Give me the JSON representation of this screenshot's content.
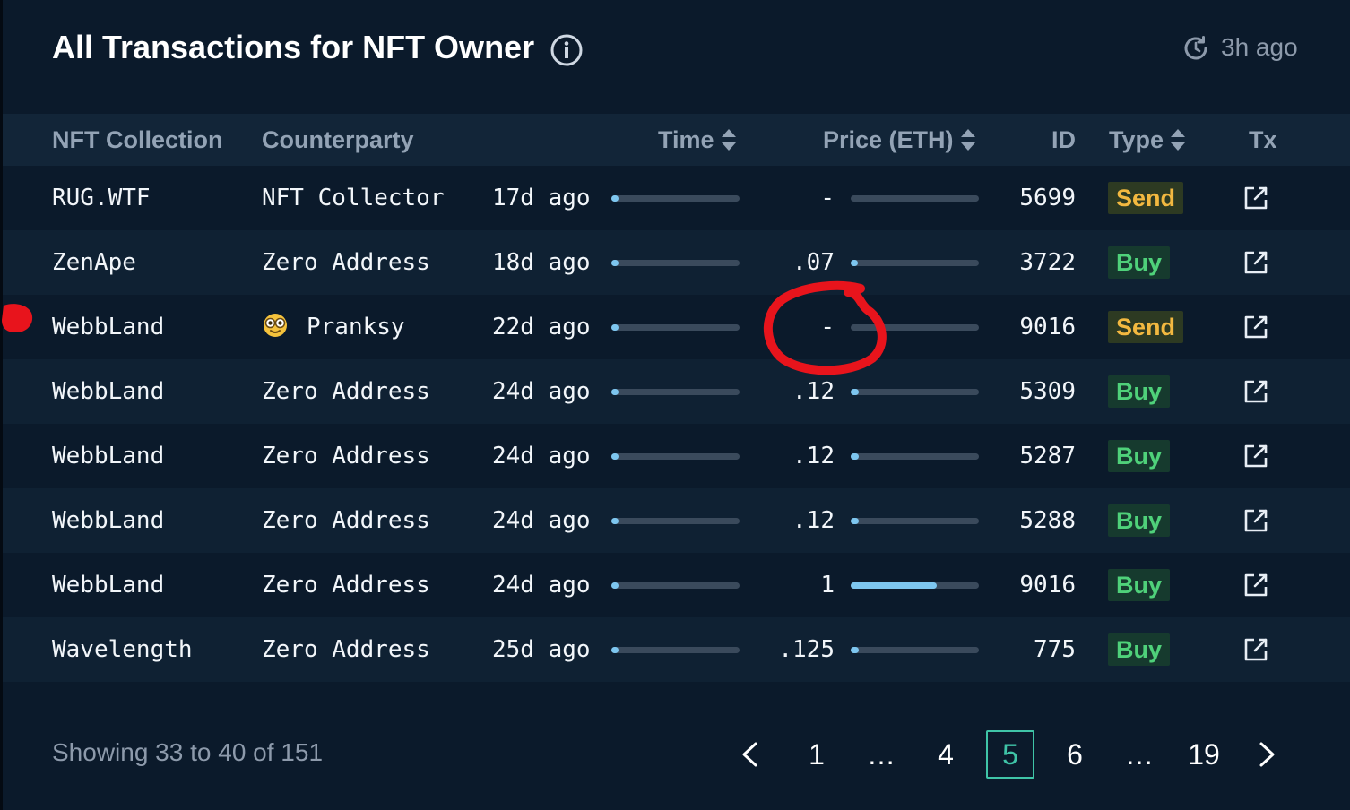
{
  "header": {
    "title": "All Transactions for NFT Owner",
    "updated": "3h ago"
  },
  "table": {
    "columns": {
      "collection": "NFT Collection",
      "counterparty": "Counterparty",
      "time": "Time",
      "price": "Price (ETH)",
      "id": "ID",
      "type": "Type",
      "tx": "Tx"
    },
    "rows": [
      {
        "collection": "RUG.WTF",
        "counterparty": "NFT Collector",
        "emoji": false,
        "time": "17d ago",
        "time_level": 0.02,
        "price": "-",
        "price_level": 0.0,
        "id": "5699",
        "type": "Send"
      },
      {
        "collection": "ZenApe",
        "counterparty": "Zero Address",
        "emoji": false,
        "time": "18d ago",
        "time_level": 0.03,
        "price": ".07",
        "price_level": 0.04,
        "id": "3722",
        "type": "Buy"
      },
      {
        "collection": "WebbLand",
        "counterparty": "Pranksy",
        "emoji": true,
        "time": "22d ago",
        "time_level": 0.04,
        "price": "-",
        "price_level": 0.0,
        "id": "9016",
        "type": "Send"
      },
      {
        "collection": "WebbLand",
        "counterparty": "Zero Address",
        "emoji": false,
        "time": "24d ago",
        "time_level": 0.05,
        "price": ".12",
        "price_level": 0.06,
        "id": "5309",
        "type": "Buy"
      },
      {
        "collection": "WebbLand",
        "counterparty": "Zero Address",
        "emoji": false,
        "time": "24d ago",
        "time_level": 0.05,
        "price": ".12",
        "price_level": 0.06,
        "id": "5287",
        "type": "Buy"
      },
      {
        "collection": "WebbLand",
        "counterparty": "Zero Address",
        "emoji": false,
        "time": "24d ago",
        "time_level": 0.05,
        "price": ".12",
        "price_level": 0.06,
        "id": "5288",
        "type": "Buy"
      },
      {
        "collection": "WebbLand",
        "counterparty": "Zero Address",
        "emoji": false,
        "time": "24d ago",
        "time_level": 0.05,
        "price": "1",
        "price_level": 0.67,
        "id": "9016",
        "type": "Buy"
      },
      {
        "collection": "Wavelength",
        "counterparty": "Zero Address",
        "emoji": false,
        "time": "25d ago",
        "time_level": 0.05,
        "price": ".125",
        "price_level": 0.06,
        "id": "775",
        "type": "Buy"
      }
    ]
  },
  "footer": {
    "showing": "Showing 33 to 40 of 151",
    "pages": [
      "1",
      "…",
      "4",
      "5",
      "6",
      "…",
      "19"
    ],
    "active_page": "5"
  },
  "icons": {
    "info": "info-icon",
    "refresh": "refresh-clock-icon",
    "sort": "sort-updown-icon",
    "tx": "external-link-icon",
    "prev": "chevron-left-icon",
    "next": "chevron-right-icon"
  },
  "colors": {
    "background": "#0b1a2b",
    "header_row": "#122538",
    "send": "#f2b840",
    "buy": "#4fd17a",
    "active_page": "#3fc4a7",
    "bar_fill": "#7dc6ef",
    "annotation": "#e8141c"
  }
}
